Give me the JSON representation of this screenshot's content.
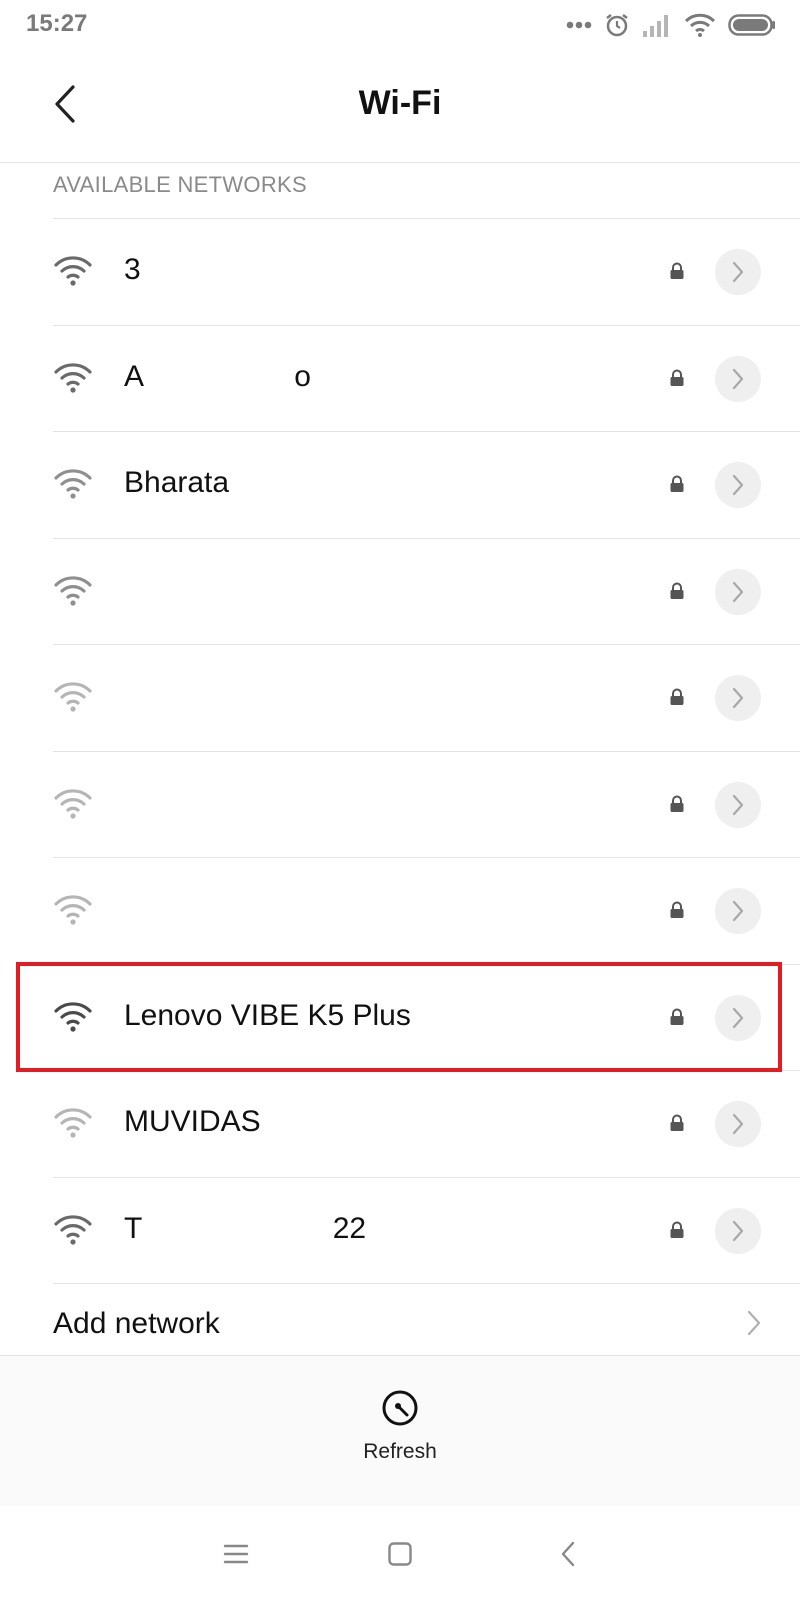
{
  "status_bar": {
    "time": "15:27",
    "icons": [
      "more-dots-icon",
      "alarm-icon",
      "signal-icon",
      "wifi-icon",
      "battery-icon"
    ]
  },
  "header": {
    "title": "Wi-Fi",
    "back_icon": "back-arrow-icon"
  },
  "section": {
    "title": "AVAILABLE NETWORKS"
  },
  "networks": [
    {
      "name": "3",
      "signal": 3,
      "secured": true
    },
    {
      "name": "A                                                            o",
      "signal": 3,
      "secured": true
    },
    {
      "name": "Bharata",
      "signal": 2,
      "secured": true
    },
    {
      "name": "",
      "signal": 2,
      "secured": true
    },
    {
      "name": "",
      "signal": 1,
      "secured": true
    },
    {
      "name": "",
      "signal": 1,
      "secured": true
    },
    {
      "name": "",
      "signal": 1,
      "secured": true
    },
    {
      "name": "Lenovo VIBE K5 Plus",
      "signal": 4,
      "secured": true,
      "highlighted": true
    },
    {
      "name": "MUVIDAS",
      "signal": 1,
      "secured": true
    },
    {
      "name": "T                                                                            22",
      "signal": 3,
      "secured": true
    }
  ],
  "add_network": {
    "label": "Add network"
  },
  "actions": {
    "refresh_label": "Refresh"
  },
  "colors": {
    "highlight": "#e31b23",
    "divider": "#e3e3e3",
    "secondary_text": "#8a8a8a"
  }
}
